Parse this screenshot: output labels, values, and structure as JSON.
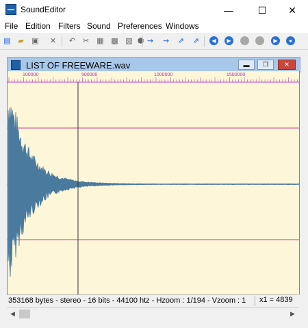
{
  "window": {
    "title": "SoundEditor"
  },
  "window_controls": {
    "minimize": "—",
    "maximize": "☐",
    "close": "✕"
  },
  "menu": [
    "File",
    "Edition",
    "Filters",
    "Sound",
    "Preferences",
    "Windows"
  ],
  "toolbar": {
    "icons": [
      "new-icon",
      "open-icon",
      "save-icon",
      "close-doc-icon",
      "undo-icon",
      "cut-icon",
      "copy-icon",
      "paste-icon",
      "paste-special-icon",
      "clipboard-icon",
      "effect1-icon",
      "effect2-icon",
      "effect3-icon",
      "effect4-icon",
      "rewind-icon",
      "play-icon",
      "pause-icon",
      "stop-icon",
      "forward-icon",
      "record-icon"
    ]
  },
  "child_window": {
    "title": "LIST OF FREEWARE.wav",
    "controls": {
      "minimize": "▬",
      "restore": "❐",
      "close": "✕"
    }
  },
  "ruler": {
    "labels": [
      "100000",
      "500000",
      "1000000",
      "1500000"
    ]
  },
  "colors": {
    "waveform": "#4a7a9e",
    "background": "#fdf6d8",
    "ruler": "#c040c0",
    "guide": "#c04090"
  },
  "status": {
    "main": "353168 bytes - stereo - 16 bits - 44100 htz - Hzoom : 1/194 - Vzoom : 1",
    "right": "x1 = 4839"
  },
  "scroll": {
    "left_arrow": "◀",
    "right_arrow": "▶"
  }
}
